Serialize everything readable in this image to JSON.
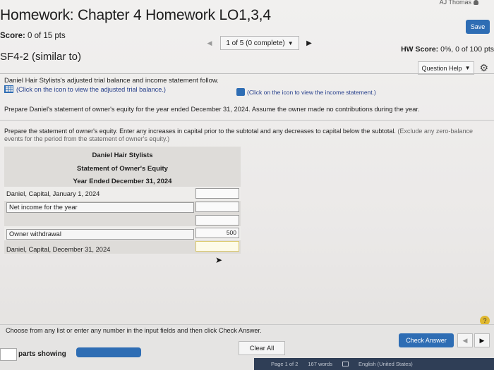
{
  "header": {
    "user": "AJ Thomas",
    "title": "Homework: Chapter 4 Homework LO1,3,4",
    "save_label": "Save",
    "score": {
      "label": "Score:",
      "value": "0 of 15 pts"
    },
    "question_nav": {
      "selected": "1 of 5 (0 complete)"
    },
    "hw_score": {
      "label": "HW Score:",
      "value": "0%, 0 of 100 pts"
    },
    "question_id": "SF4-2 (similar to)",
    "question_help_label": "Question Help"
  },
  "question": {
    "intro": "Daniel Hair Stylists's adjusted trial balance and income statement follow.",
    "link_trial_balance": "(Click on the icon to view the adjusted trial balance.)",
    "link_income_statement": "(Click on the icon to view the income statement.)",
    "task": "Prepare Daniel's statement of owner's equity for the year ended December 31, 2024. Assume the owner made no contributions during the year.",
    "instruction_main": "Prepare the statement of owner's equity. Enter any increases in capital prior to the subtotal and any decreases to capital below the subtotal.",
    "instruction_note": "(Exclude any zero-balance events for the period from the statement of owner's equity.)"
  },
  "statement": {
    "company": "Daniel Hair Stylists",
    "name": "Statement of Owner's Equity",
    "period": "Year Ended December 31, 2024",
    "rows": [
      {
        "label": "Daniel, Capital, January 1, 2024",
        "value": ""
      },
      {
        "label": "Net income for the year",
        "value": ""
      },
      {
        "label": "",
        "value": ""
      },
      {
        "label": "Owner withdrawal",
        "value": "500"
      },
      {
        "label": "Daniel, Capital, December 31, 2024",
        "value": ""
      }
    ]
  },
  "footer": {
    "choose_text": "Choose from any list or enter any number in the input fields and then click Check Answer.",
    "check_answer_label": "Check Answer",
    "clear_all_label": "Clear All",
    "parts_label": "parts showing",
    "help_label": "?",
    "status": {
      "page": "Page 1 of 2",
      "words": "167 words",
      "language": "English (United States)"
    }
  }
}
